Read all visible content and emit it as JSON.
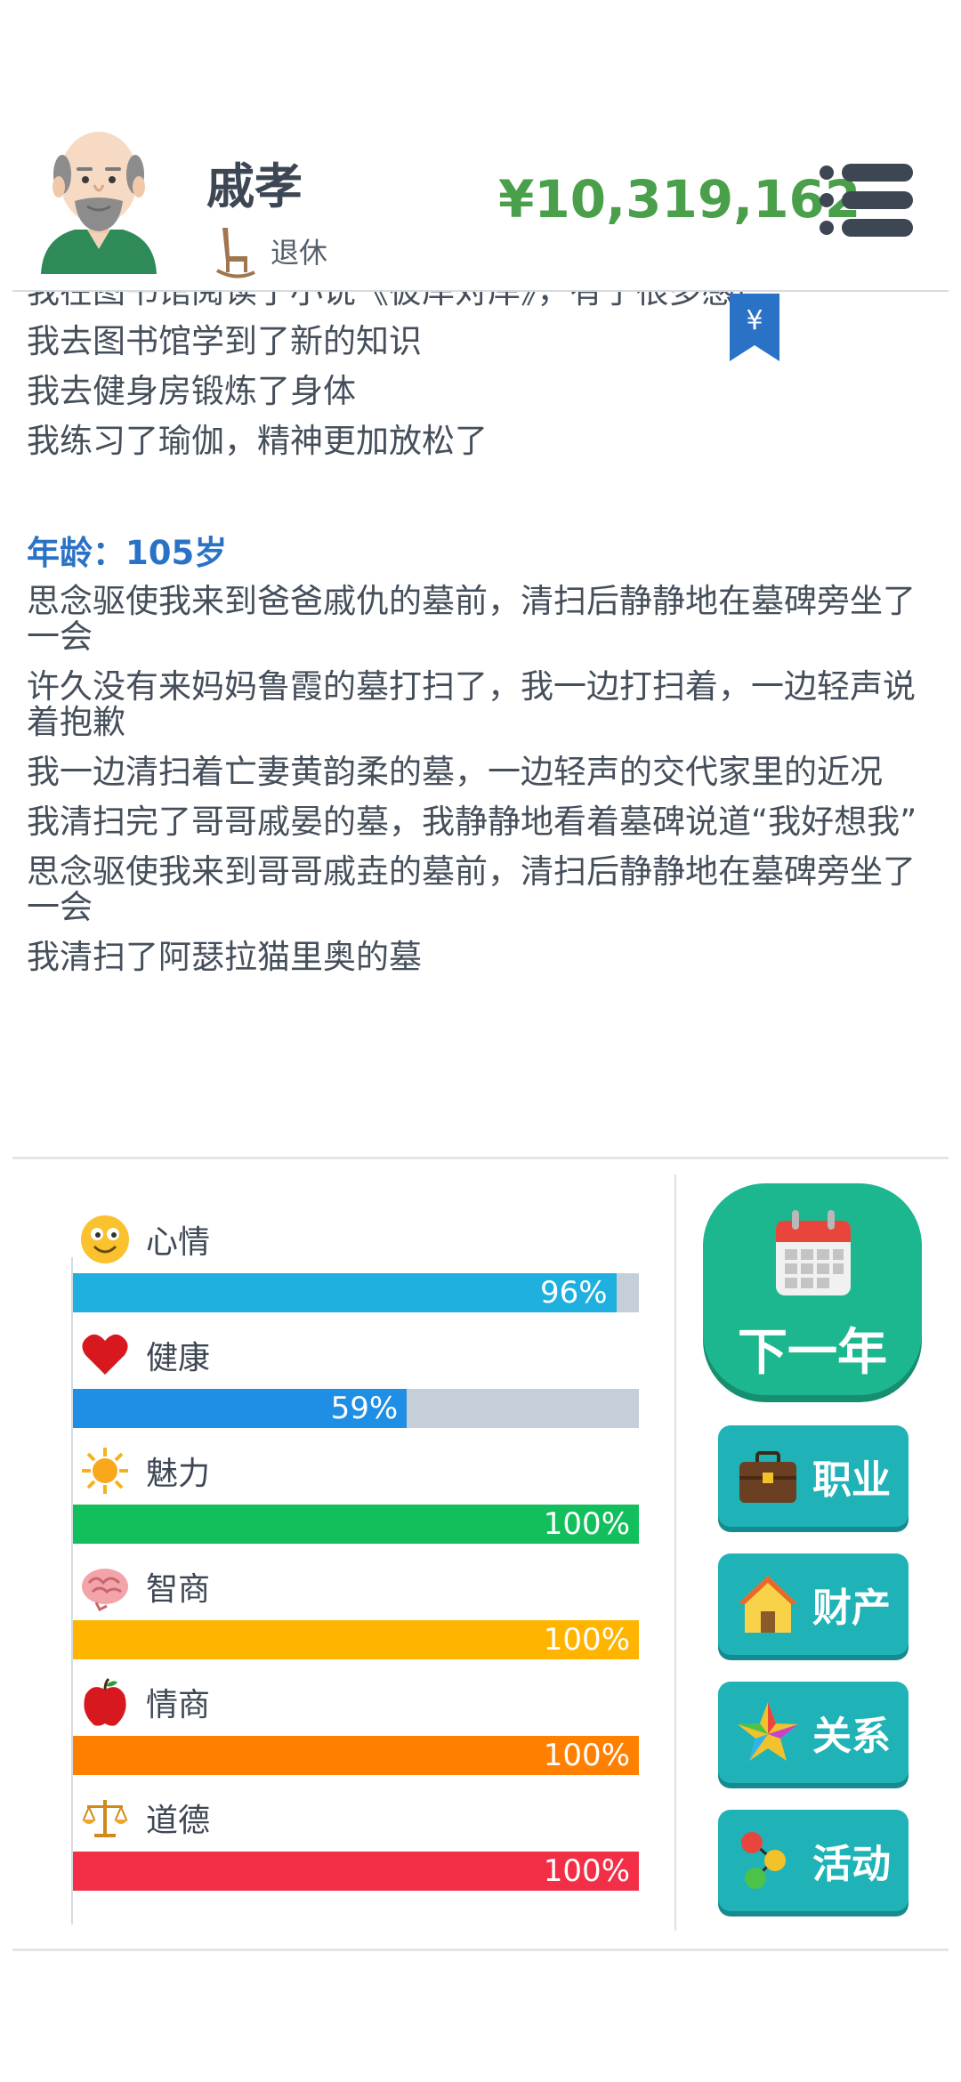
{
  "header": {
    "name": "戚孝",
    "status": "退休",
    "money": "¥10,319,162",
    "avatar_icon": "old-man-avatar",
    "status_icon": "rocking-chair-icon",
    "menu_icon": "menu-icon"
  },
  "log": {
    "lines_before": [
      "我在图书馆阅读了小说《彼岸对岸》，有了很多感悟",
      "我去图书馆学到了新的知识",
      "我去健身房锻炼了身体",
      "我练习了瑜伽，精神更加放松了"
    ],
    "age_label": "年龄：105岁",
    "lines_after": [
      "思念驱使我来到爸爸戚仇的墓前，清扫后静静地在墓碑旁坐了一会",
      "许久没有来妈妈鲁霞的墓打扫了，我一边打扫着，一边轻声说着抱歉",
      "我一边清扫着亡妻黄韵柔的墓，一边轻声的交代家里的近况",
      "我清扫完了哥哥戚晏的墓，我静静地看着墓碑说道“我好想我”",
      "思念驱使我来到哥哥戚垚的墓前，清扫后静静地在墓碑旁坐了一会",
      "我清扫了阿瑟拉猫里奥的墓"
    ],
    "bookmark_icon": "yen-bookmark-icon"
  },
  "stats": [
    {
      "name": "心情",
      "value": 96,
      "label": "96%",
      "color": "#1fb0e0",
      "icon": "smiley-icon"
    },
    {
      "name": "健康",
      "value": 59,
      "label": "59%",
      "color": "#1f8fe6",
      "icon": "heart-icon"
    },
    {
      "name": "魅力",
      "value": 100,
      "label": "100%",
      "color": "#12bf5c",
      "icon": "sun-icon"
    },
    {
      "name": "智商",
      "value": 100,
      "label": "100%",
      "color": "#ffb400",
      "icon": "brain-icon"
    },
    {
      "name": "情商",
      "value": 100,
      "label": "100%",
      "color": "#ff8000",
      "icon": "apple-icon"
    },
    {
      "name": "道德",
      "value": 100,
      "label": "100%",
      "color": "#f22f46",
      "icon": "scales-icon"
    }
  ],
  "actions": {
    "next_year": "下一年",
    "career": "职业",
    "property": "财产",
    "relations": "关系",
    "activities": "活动"
  }
}
